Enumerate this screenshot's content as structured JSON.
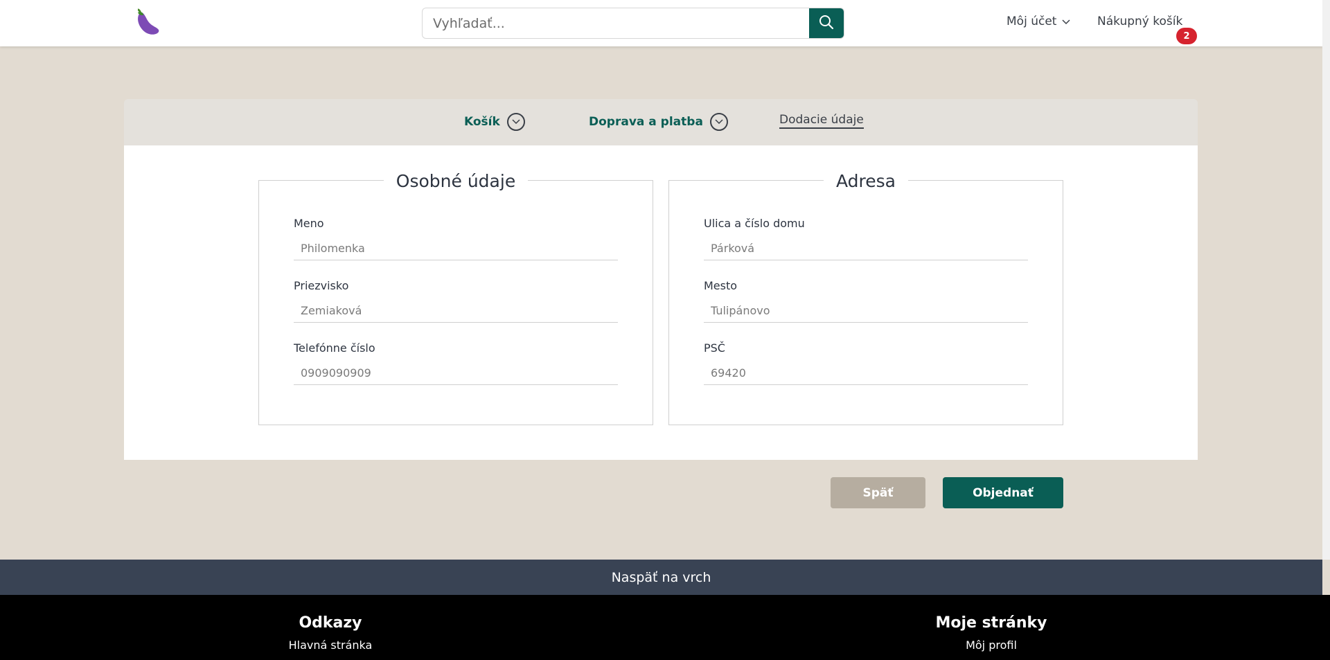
{
  "header": {
    "logo_icon": "eggplant-icon",
    "search": {
      "placeholder": "Vyhľadať...",
      "button_icon": "search-icon"
    },
    "account_label": "Môj účet",
    "cart_label": "Nákupný košík",
    "cart_count": "2"
  },
  "steps": [
    {
      "label": "Košík",
      "icon": "chevron-down-circle-icon"
    },
    {
      "label": "Doprava a platba",
      "icon": "chevron-down-circle-icon"
    },
    {
      "label": "Dodacie údaje"
    }
  ],
  "personal": {
    "title": "Osobné údaje",
    "fields": [
      {
        "label": "Meno",
        "placeholder": "Philomenka"
      },
      {
        "label": "Priezvisko",
        "placeholder": "Zemiaková"
      },
      {
        "label": "Telefónne číslo",
        "placeholder": "0909090909"
      }
    ]
  },
  "address": {
    "title": "Adresa",
    "fields": [
      {
        "label": "Ulica a číslo domu",
        "placeholder": "Párková"
      },
      {
        "label": "Mesto",
        "placeholder": "Tulipánovo"
      },
      {
        "label": "PSČ",
        "placeholder": "69420"
      }
    ]
  },
  "actions": {
    "back_label": "Späť",
    "order_label": "Objednať"
  },
  "footer": {
    "back_to_top": "Naspäť na vrch",
    "columns": [
      {
        "title": "Odkazy",
        "first_link": "Hlavná stránka"
      },
      {
        "title": "Moje stránky",
        "first_link": "Môj profil"
      }
    ]
  },
  "colors": {
    "brand": "#0a5e55",
    "background": "#e2dbd1",
    "badge": "#d6232e",
    "footer_bar": "#394354"
  }
}
